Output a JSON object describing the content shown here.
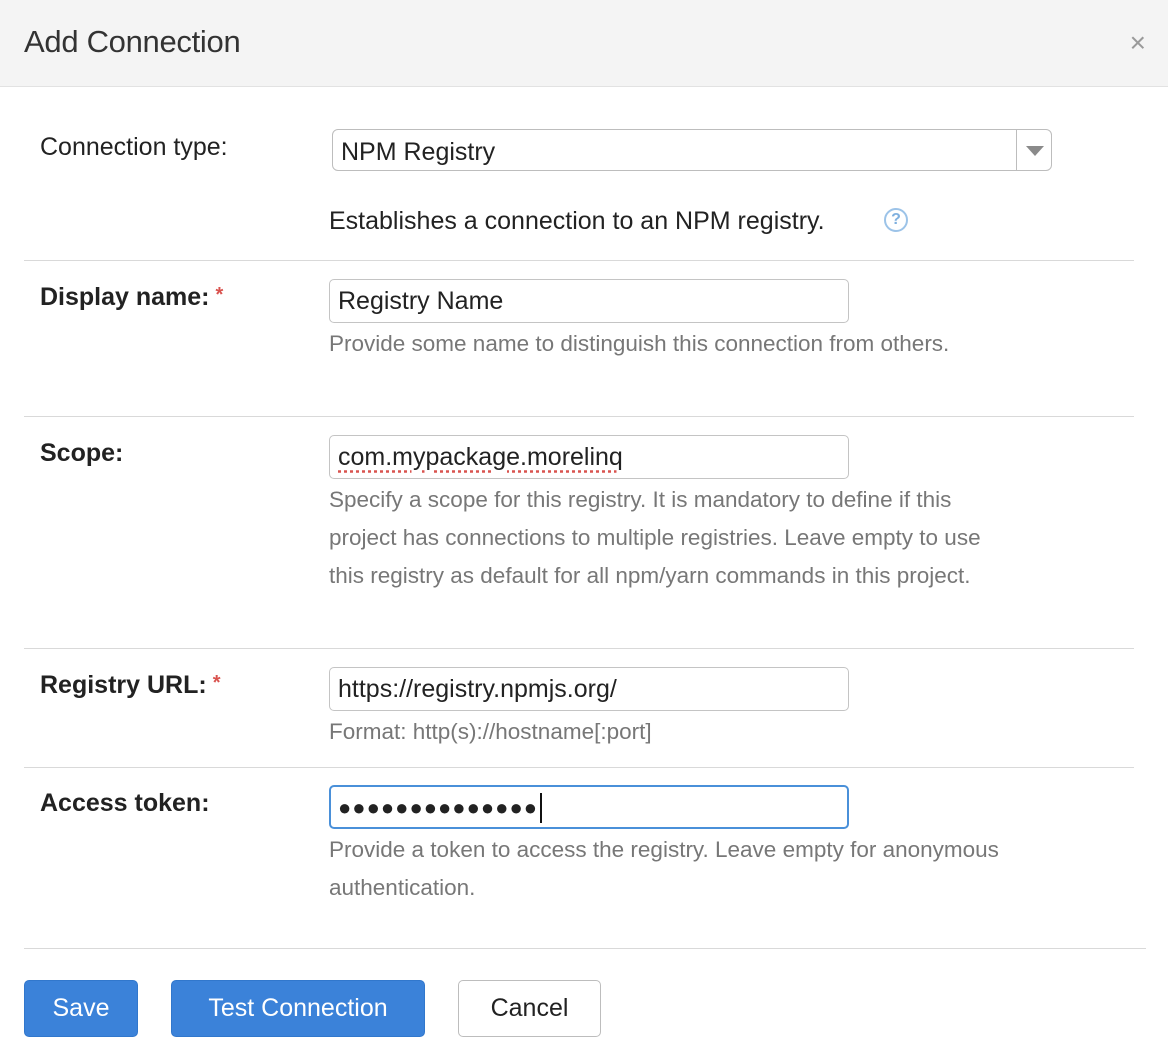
{
  "dialog": {
    "title": "Add Connection",
    "close_label": "×"
  },
  "connection_type": {
    "label": "Connection type:",
    "selected": "NPM Registry",
    "description": "Establishes a connection to an NPM registry.",
    "help_label": "?"
  },
  "display_name": {
    "label": "Display name:",
    "required_mark": "*",
    "value": "Registry Name",
    "hint": "Provide some name to distinguish this connection from others."
  },
  "scope": {
    "label": "Scope:",
    "value": "com.mypackage.morelinq",
    "hint": "Specify a scope for this registry. It is mandatory to define if this project has connections to multiple registries. Leave empty to use this registry as default for all npm/yarn commands in this project."
  },
  "registry_url": {
    "label": "Registry URL:",
    "required_mark": "*",
    "value": "https://registry.npmjs.org/",
    "hint": "Format: http(s)://hostname[:port]"
  },
  "access_token": {
    "label": "Access token:",
    "masked_value": "●●●●●●●●●●●●●●",
    "hint": "Provide a token to access the registry. Leave empty for anonymous authentication."
  },
  "buttons": {
    "save": "Save",
    "test": "Test Connection",
    "cancel": "Cancel"
  },
  "colors": {
    "primary": "#3b82d9",
    "required": "#d9534f",
    "focus": "#4a90d9"
  }
}
